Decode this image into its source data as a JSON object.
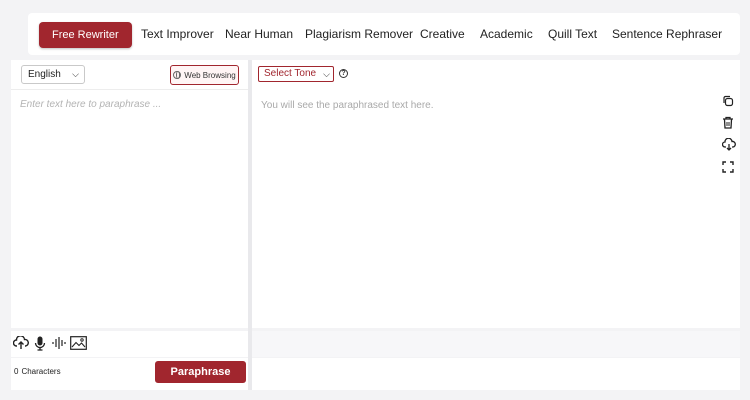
{
  "modes": [
    {
      "label": "Free Rewriter",
      "active": true
    },
    {
      "label": "Text Improver",
      "active": false
    },
    {
      "label": "Near Human",
      "active": false
    },
    {
      "label": "Plagiarism Remover",
      "active": false
    },
    {
      "label": "Creative",
      "active": false
    },
    {
      "label": "Academic",
      "active": false
    },
    {
      "label": "Quill Text",
      "active": false
    },
    {
      "label": "Sentence Rephraser",
      "active": false
    }
  ],
  "input": {
    "language": "English",
    "web_browsing_label": "Web Browsing",
    "placeholder": "Enter text here to paraphrase ...",
    "char_count": "0",
    "char_label": "Characters",
    "paraphrase_label": "Paraphrase",
    "tools": [
      "upload-cloud-icon",
      "microphone-icon",
      "audio-wave-icon",
      "image-icon"
    ]
  },
  "output": {
    "tone": "Select Tone",
    "placeholder": "You will see the paraphrased text here.",
    "actions": [
      "copy-icon",
      "trash-icon",
      "download-cloud-icon",
      "fullscreen-icon"
    ]
  },
  "colors": {
    "accent": "#a1262e",
    "background": "#f3f3f5",
    "panel": "#ffffff"
  }
}
